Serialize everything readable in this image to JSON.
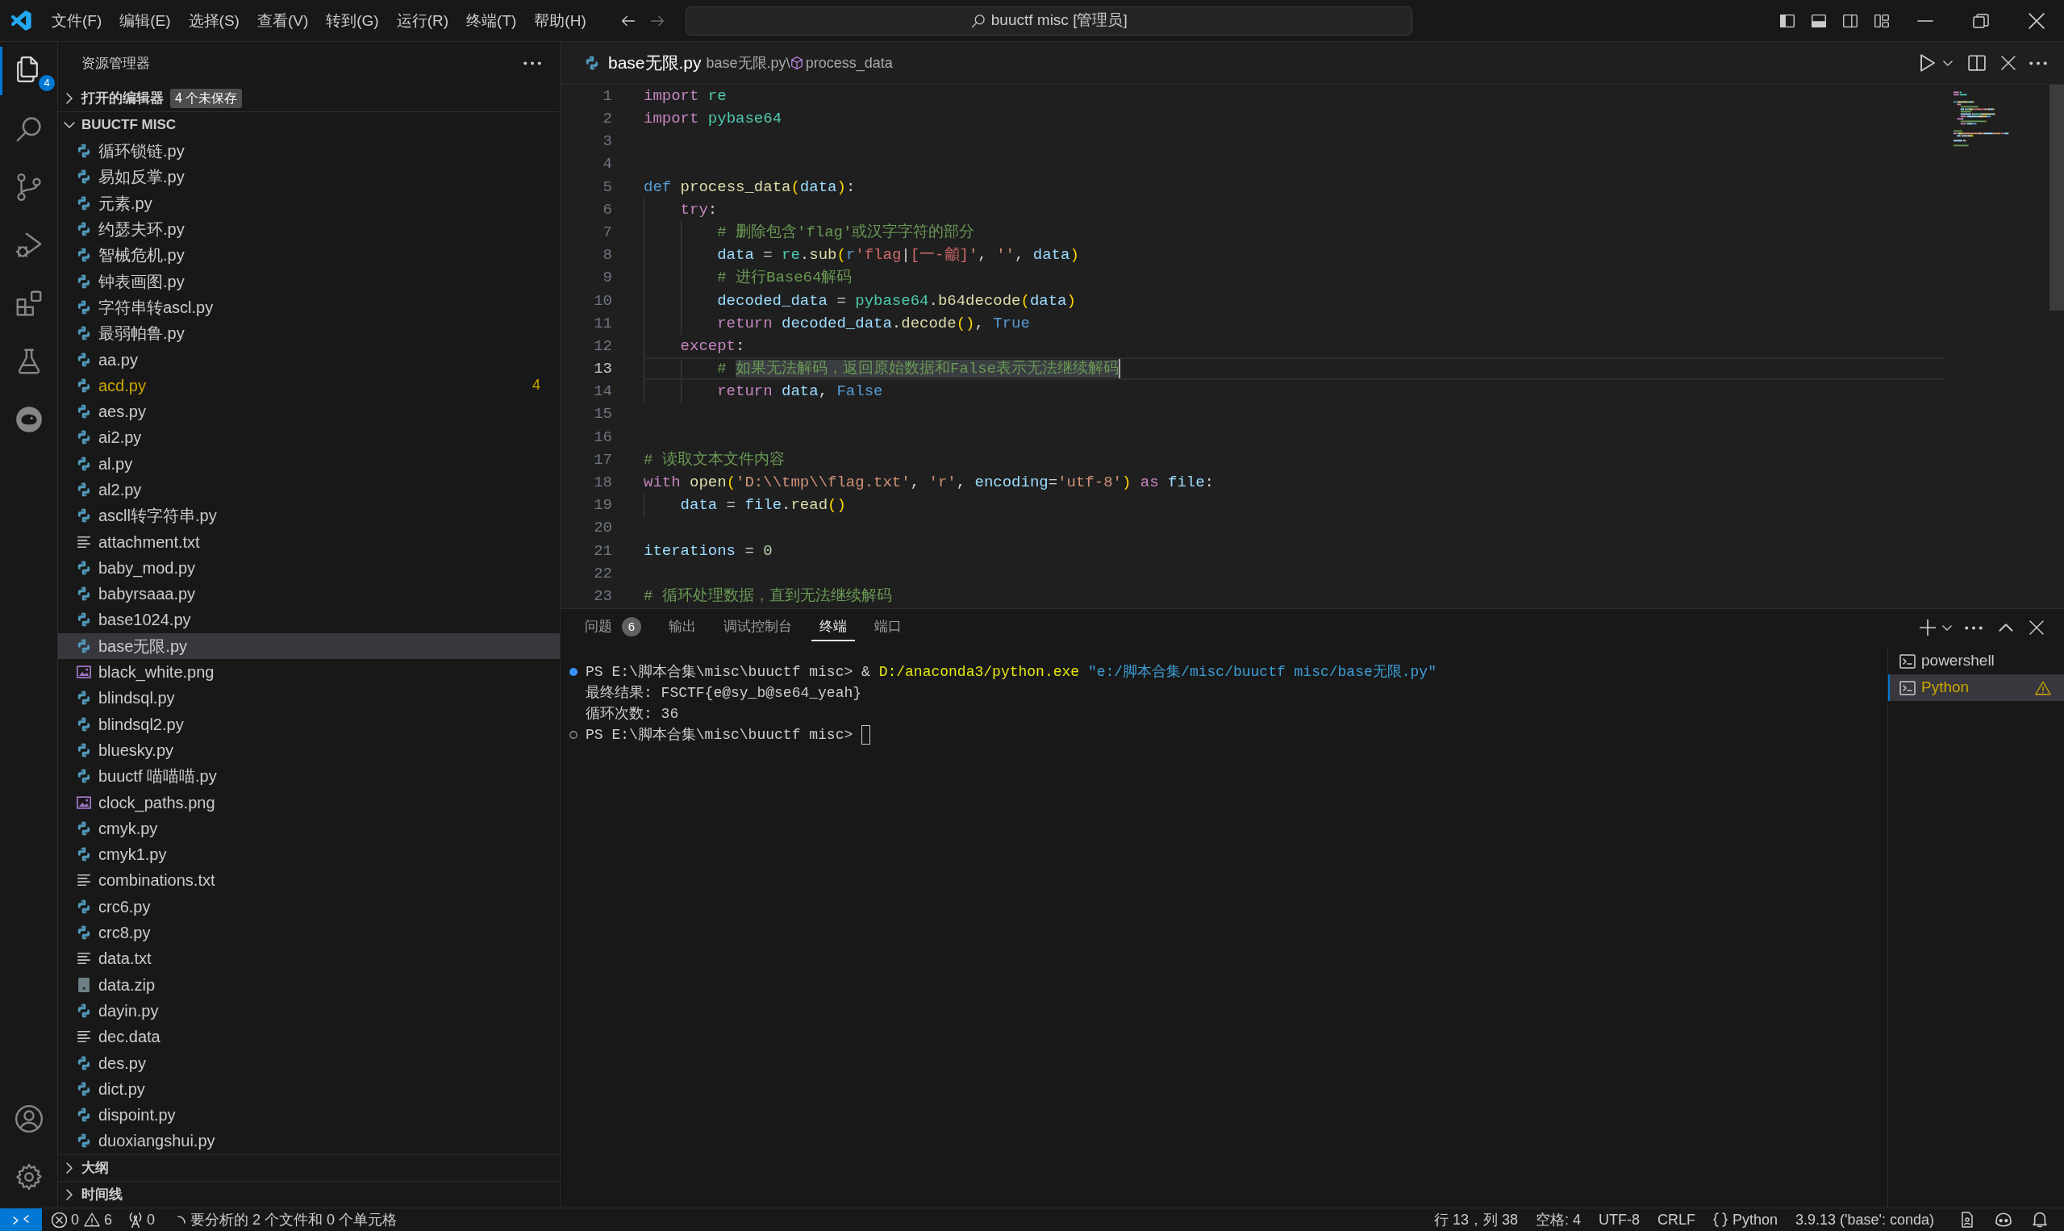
{
  "title_bar": {
    "menus": [
      "文件(F)",
      "编辑(E)",
      "选择(S)",
      "查看(V)",
      "转到(G)",
      "运行(R)",
      "终端(T)",
      "帮助(H)"
    ],
    "command_center": "buuctf misc [管理员]"
  },
  "activity_bar": {
    "items": [
      {
        "kind": "explorer",
        "selected": true,
        "badge": "4"
      },
      {
        "kind": "search",
        "selected": false
      },
      {
        "kind": "source_control",
        "selected": false
      },
      {
        "kind": "run_debug",
        "selected": false
      },
      {
        "kind": "extensions",
        "selected": false
      },
      {
        "kind": "testing",
        "selected": false
      },
      {
        "kind": "emblem",
        "selected": false
      }
    ],
    "bottom_items": [
      {
        "kind": "account"
      },
      {
        "kind": "settings"
      }
    ]
  },
  "sidebar": {
    "title": "资源管理器",
    "open_editors": {
      "label": "打开的编辑器",
      "expanded": false,
      "badge": "4 个未保存"
    },
    "folder": {
      "label": "BUUCTF MISC",
      "expanded": true,
      "files": [
        {
          "name": "循环锁链.py",
          "kind": "python",
          "selected": false
        },
        {
          "name": "易如反掌.py",
          "kind": "python",
          "selected": false
        },
        {
          "name": "元素.py",
          "kind": "python",
          "selected": false
        },
        {
          "name": "约瑟夫环.py",
          "kind": "python",
          "selected": false
        },
        {
          "name": "智械危机.py",
          "kind": "python",
          "selected": false
        },
        {
          "name": "钟表画图.py",
          "kind": "python",
          "selected": false
        },
        {
          "name": "字符串转ascl.py",
          "kind": "python",
          "selected": false
        },
        {
          "name": "最弱帕鲁.py",
          "kind": "python",
          "selected": false
        },
        {
          "name": "aa.py",
          "kind": "python",
          "selected": false
        },
        {
          "name": "acd.py",
          "kind": "python",
          "selected": false,
          "problems": "4"
        },
        {
          "name": "aes.py",
          "kind": "python",
          "selected": false
        },
        {
          "name": "ai2.py",
          "kind": "python",
          "selected": false
        },
        {
          "name": "al.py",
          "kind": "python",
          "selected": false
        },
        {
          "name": "al2.py",
          "kind": "python",
          "selected": false
        },
        {
          "name": "ascll转字符串.py",
          "kind": "python",
          "selected": false
        },
        {
          "name": "attachment.txt",
          "kind": "text",
          "selected": false
        },
        {
          "name": "baby_mod.py",
          "kind": "python",
          "selected": false
        },
        {
          "name": "babyrsaaa.py",
          "kind": "python",
          "selected": false
        },
        {
          "name": "base1024.py",
          "kind": "python",
          "selected": false
        },
        {
          "name": "base无限.py",
          "kind": "python",
          "selected": true
        },
        {
          "name": "black_white.png",
          "kind": "image",
          "selected": false
        },
        {
          "name": "blindsql.py",
          "kind": "python",
          "selected": false
        },
        {
          "name": "blindsql2.py",
          "kind": "python",
          "selected": false
        },
        {
          "name": "bluesky.py",
          "kind": "python",
          "selected": false
        },
        {
          "name": "buuctf 喵喵喵.py",
          "kind": "python",
          "selected": false
        },
        {
          "name": "clock_paths.png",
          "kind": "image",
          "selected": false
        },
        {
          "name": "cmyk.py",
          "kind": "python",
          "selected": false
        },
        {
          "name": "cmyk1.py",
          "kind": "python",
          "selected": false
        },
        {
          "name": "combinations.txt",
          "kind": "text",
          "selected": false
        },
        {
          "name": "crc6.py",
          "kind": "python",
          "selected": false
        },
        {
          "name": "crc8.py",
          "kind": "python",
          "selected": false
        },
        {
          "name": "data.txt",
          "kind": "text",
          "selected": false
        },
        {
          "name": "data.zip",
          "kind": "archive",
          "selected": false
        },
        {
          "name": "dayin.py",
          "kind": "python",
          "selected": false
        },
        {
          "name": "dec.data",
          "kind": "text",
          "selected": false
        },
        {
          "name": "des.py",
          "kind": "python",
          "selected": false
        },
        {
          "name": "dict.py",
          "kind": "python",
          "selected": false
        },
        {
          "name": "dispoint.py",
          "kind": "python",
          "selected": false
        },
        {
          "name": "duoxiangshui.py",
          "kind": "python",
          "selected": false
        }
      ]
    },
    "sections": [
      {
        "label": "大纲",
        "expanded": false
      },
      {
        "label": "时间线",
        "expanded": false
      }
    ]
  },
  "editor": {
    "tab": {
      "label": "base无限.py"
    },
    "breadcrumbs": {
      "file": "base无限.py",
      "separator": "\\",
      "symbol": "process_data"
    },
    "lines": [
      {
        "number": "1",
        "current": false,
        "tokens": [
          {
            "text": "import",
            "kind": "keyword"
          },
          {
            "text": " re",
            "kind": "module"
          }
        ]
      },
      {
        "number": "2",
        "current": false,
        "tokens": [
          {
            "text": "import",
            "kind": "keyword"
          },
          {
            "text": " pybase64",
            "kind": "module"
          }
        ]
      },
      {
        "number": "3",
        "current": false
      },
      {
        "number": "4",
        "current": false
      },
      {
        "number": "5",
        "current": false,
        "tokens": [
          {
            "text": "def",
            "kind": "storage"
          },
          {
            "text": " process_data",
            "kind": "function"
          },
          {
            "text": "(",
            "kind": "bracket"
          },
          {
            "text": "data",
            "kind": "variable"
          },
          {
            "text": ")",
            "kind": "bracket"
          },
          {
            "text": ":",
            "kind": "operator"
          }
        ]
      },
      {
        "number": "6",
        "current": false,
        "tokens": [
          {
            "text": "    try",
            "kind": "keyword"
          },
          {
            "text": ":",
            "kind": "operator"
          }
        ]
      },
      {
        "number": "7",
        "current": false,
        "tokens": [
          {
            "text": "        # 删除包含'flag'或汉字字符的部分",
            "kind": "comment"
          }
        ]
      },
      {
        "number": "8",
        "current": false,
        "tokens": [
          {
            "text": "        data",
            "kind": "variable"
          },
          {
            "text": " = ",
            "kind": "operator"
          },
          {
            "text": "re",
            "kind": "module"
          },
          {
            "text": ".",
            "kind": "operator"
          },
          {
            "text": "sub",
            "kind": "function"
          },
          {
            "text": "(",
            "kind": "bracket"
          },
          {
            "text": "r",
            "kind": "storage"
          },
          {
            "text": "'flag",
            "kind": "regex"
          },
          {
            "text": "|",
            "kind": "regex_operator"
          },
          {
            "text": "[一-龥]",
            "kind": "regex"
          },
          {
            "text": "'",
            "kind": "string"
          },
          {
            "text": ", ",
            "kind": "operator"
          },
          {
            "text": "''",
            "kind": "string"
          },
          {
            "text": ", ",
            "kind": "operator"
          },
          {
            "text": "data",
            "kind": "variable"
          },
          {
            "text": ")",
            "kind": "bracket"
          }
        ]
      },
      {
        "number": "9",
        "current": false,
        "tokens": [
          {
            "text": "        # 进行Base64解码",
            "kind": "comment"
          }
        ]
      },
      {
        "number": "10",
        "current": false,
        "tokens": [
          {
            "text": "        decoded_data",
            "kind": "variable"
          },
          {
            "text": " = ",
            "kind": "operator"
          },
          {
            "text": "pybase64",
            "kind": "module"
          },
          {
            "text": ".",
            "kind": "operator"
          },
          {
            "text": "b64decode",
            "kind": "function"
          },
          {
            "text": "(",
            "kind": "bracket"
          },
          {
            "text": "data",
            "kind": "variable"
          },
          {
            "text": ")",
            "kind": "bracket"
          }
        ]
      },
      {
        "number": "11",
        "current": false,
        "tokens": [
          {
            "text": "        return",
            "kind": "keyword"
          },
          {
            "text": " decoded_data",
            "kind": "variable"
          },
          {
            "text": ".",
            "kind": "operator"
          },
          {
            "text": "decode",
            "kind": "function"
          },
          {
            "text": "()",
            "kind": "bracket"
          },
          {
            "text": ", ",
            "kind": "operator"
          },
          {
            "text": "True",
            "kind": "constant"
          }
        ]
      },
      {
        "number": "12",
        "current": false,
        "tokens": [
          {
            "text": "    except",
            "kind": "keyword"
          },
          {
            "text": ":",
            "kind": "operator"
          }
        ]
      },
      {
        "number": "13",
        "current": true,
        "tokens": [
          {
            "text": "        # ",
            "kind": "comment"
          },
          {
            "text": "如果无法解码，返回原始数据和False表示无法继续解码",
            "kind": "selection"
          }
        ]
      },
      {
        "number": "14",
        "current": false,
        "tokens": [
          {
            "text": "        return",
            "kind": "keyword"
          },
          {
            "text": " data",
            "kind": "variable"
          },
          {
            "text": ", ",
            "kind": "operator"
          },
          {
            "text": "False",
            "kind": "constant"
          }
        ]
      },
      {
        "number": "15",
        "current": false
      },
      {
        "number": "16",
        "current": false
      },
      {
        "number": "17",
        "current": false,
        "tokens": [
          {
            "text": "# 读取文本文件内容",
            "kind": "comment"
          }
        ]
      },
      {
        "number": "18",
        "current": false,
        "tokens": [
          {
            "text": "with",
            "kind": "keyword"
          },
          {
            "text": " open",
            "kind": "function"
          },
          {
            "text": "(",
            "kind": "bracket"
          },
          {
            "text": "'D:\\\\tmp\\\\flag.txt'",
            "kind": "string"
          },
          {
            "text": ", ",
            "kind": "operator"
          },
          {
            "text": "'r'",
            "kind": "string"
          },
          {
            "text": ", ",
            "kind": "operator"
          },
          {
            "text": "encoding",
            "kind": "variable"
          },
          {
            "text": "=",
            "kind": "operator"
          },
          {
            "text": "'utf-8'",
            "kind": "string"
          },
          {
            "text": ")",
            "kind": "bracket"
          },
          {
            "text": " as",
            "kind": "keyword"
          },
          {
            "text": " file",
            "kind": "variable"
          },
          {
            "text": ":",
            "kind": "operator"
          }
        ]
      },
      {
        "number": "19",
        "current": false,
        "tokens": [
          {
            "text": "    data",
            "kind": "variable"
          },
          {
            "text": " = ",
            "kind": "operator"
          },
          {
            "text": "file",
            "kind": "variable"
          },
          {
            "text": ".",
            "kind": "operator"
          },
          {
            "text": "read",
            "kind": "function"
          },
          {
            "text": "()",
            "kind": "bracket"
          }
        ]
      },
      {
        "number": "20",
        "current": false
      },
      {
        "number": "21",
        "current": false,
        "tokens": [
          {
            "text": "iterations",
            "kind": "variable"
          },
          {
            "text": " = ",
            "kind": "operator"
          },
          {
            "text": "0",
            "kind": "number"
          }
        ]
      },
      {
        "number": "22",
        "current": false
      },
      {
        "number": "23",
        "current": false,
        "tokens": [
          {
            "text": "# 循环处理数据，直到无法继续解码",
            "kind": "comment"
          }
        ]
      }
    ]
  },
  "panel": {
    "tabs": [
      {
        "label": "问题",
        "badge": "6",
        "selected": false
      },
      {
        "label": "输出",
        "selected": false
      },
      {
        "label": "调试控制台",
        "selected": false
      },
      {
        "label": "终端",
        "selected": true
      },
      {
        "label": "端口",
        "selected": false
      }
    ],
    "terminal": {
      "lines": [
        {
          "kind": "done",
          "cursor": false,
          "tokens": [
            {
              "text": "PS E:\\脚本合集\\misc\\buuctf misc> & ",
              "kind": "plain"
            },
            {
              "text": "D:/anaconda3/python.exe",
              "kind": "command"
            },
            {
              "text": " \"e:/脚本合集/misc/buuctf misc/base无限.py\"",
              "kind": "string"
            }
          ]
        },
        {
          "kind": "output",
          "cursor": false,
          "tokens": [
            {
              "text": "最终结果: FSCTF{e@sy_b@se64_yeah}",
              "kind": "plain"
            }
          ]
        },
        {
          "kind": "output",
          "cursor": false,
          "tokens": [
            {
              "text": "循环次数: 36",
              "kind": "plain"
            }
          ]
        },
        {
          "kind": "active",
          "cursor": true,
          "tokens": [
            {
              "text": "PS E:\\脚本合集\\misc\\buuctf misc> ",
              "kind": "plain"
            }
          ]
        }
      ]
    },
    "terminals": [
      {
        "label": "powershell",
        "selected": false,
        "warning": false
      },
      {
        "label": "Python",
        "selected": true,
        "warning": true
      }
    ]
  },
  "status_bar": {
    "left": [
      {
        "kind": "remote"
      },
      {
        "kind": "problems",
        "errors": "0",
        "warnings": "6"
      },
      {
        "kind": "ports",
        "count": "0"
      },
      {
        "kind": "progress",
        "text": "要分析的 2 个文件和 0 个单元格"
      }
    ],
    "right": [
      {
        "kind": "text",
        "text": "行 13，列 38"
      },
      {
        "kind": "text",
        "text": "空格: 4"
      },
      {
        "kind": "text",
        "text": "UTF-8"
      },
      {
        "kind": "text",
        "text": "CRLF"
      },
      {
        "kind": "language",
        "text": "Python"
      },
      {
        "kind": "text",
        "text": "3.9.13 ('base': conda)"
      },
      {
        "kind": "feedback"
      },
      {
        "kind": "assistant"
      },
      {
        "kind": "notifications"
      }
    ]
  }
}
